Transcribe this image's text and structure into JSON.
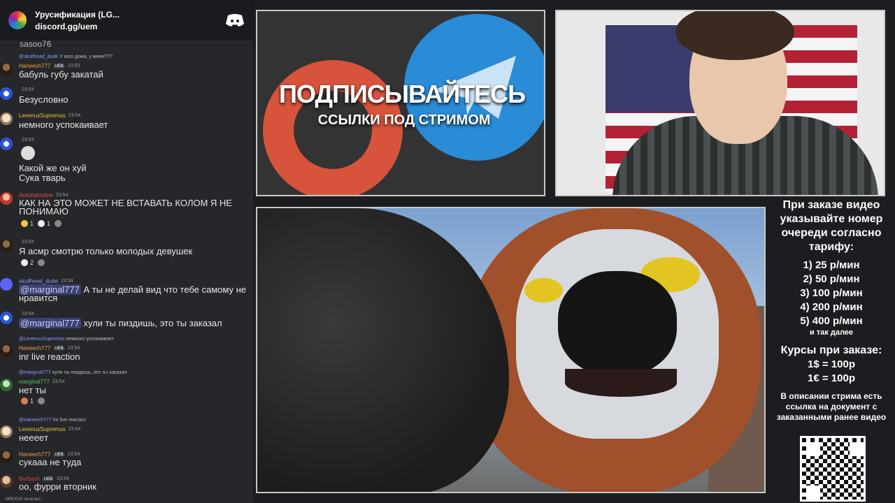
{
  "chat_header": {
    "server_name": "Урусификация (LG...",
    "invite": "discord.gg/uem",
    "icon": "discord-logo-icon"
  },
  "cut_text": "sasoo76",
  "messages": [
    {
      "reply": {
        "name": "@skullhead_dude",
        "text": "У кого дома, у меня???"
      },
      "author": "Haneech777",
      "author_color": "#f0a040",
      "badge": "UEB",
      "time": "23:53",
      "text": "бабуль губу закатай"
    },
    {
      "author": "",
      "time": "23:54",
      "text": "Безусловно"
    },
    {
      "author": "LevenusSupremus",
      "author_color": "#f0c040",
      "time": "23:54",
      "text": "немного успокаивает"
    },
    {
      "author": "",
      "time": "23:54",
      "text_line1": "Какой же он хуй",
      "text_line2": "Сука тварь"
    },
    {
      "author": "Autobatostine",
      "author_color": "#e05050",
      "time": "23:54",
      "text": "КАК НА ЭТО МОЖЕТ НЕ ВСТАВАТЬ КОЛОМ Я НЕ ПОНИМАЮ",
      "reactions": [
        "1",
        "1"
      ]
    },
    {
      "author": "",
      "time": "23:54",
      "text": "Я асмр смотрю только молодых девушек",
      "reactions": [
        "2"
      ]
    },
    {
      "author": "skullhead_dude",
      "author_color": "#8c9bff",
      "time": "23:54",
      "mention": "@marginal777",
      "text": " А ты не делай вид что тебе самому не нравится"
    },
    {
      "author": "",
      "time": "23:54",
      "mention": "@marginal777",
      "text": " хули ты пиздишь, это ты заказал"
    },
    {
      "reply": {
        "name": "@LevenusSupremus",
        "text": "немного успокаивает"
      },
      "author": "Haneech777",
      "author_color": "#f0a040",
      "badge": "UEB",
      "time": "23:54",
      "text": "inr live reaction"
    },
    {
      "reply": {
        "name": "@marginal777",
        "text": "хули ты пиздишь, это ты заказал"
      },
      "author": "marginal777",
      "author_color": "#50c050",
      "time": "23:54",
      "text": "нет ты",
      "reactions": [
        "1"
      ]
    },
    {
      "reply": {
        "name": "@Haneech777",
        "text": "inr live reaction"
      },
      "author": "LevenusSupremus",
      "author_color": "#f0c040",
      "time": "23:54",
      "text": "нееeeт"
    },
    {
      "author": "Haneech777",
      "author_color": "#f0a040",
      "badge": "UEB",
      "time": "23:54",
      "text": "сукааа не туда"
    },
    {
      "author": "Burbach",
      "author_color": "#e04040",
      "badge": "UEB",
      "time": "23:54",
      "text": "оо, фурри вторник"
    }
  ],
  "typing": "MIB2024 печатает...",
  "promo": {
    "title": "ПОДПИСЫВАЙТЕСЬ",
    "subtitle": "ССЫЛКИ ПОД СТРИМОМ"
  },
  "info": {
    "heading": "При заказе видео указывайте номер очереди согласно тарифу:",
    "tariffs": [
      "1) 25 р/мин",
      "2) 50 р/мин",
      "3) 100 р/мин",
      "4) 200 р/мин",
      "5) 400 р/мин"
    ],
    "etc": "и так далее",
    "rates_title": "Курсы при заказе:",
    "rates": [
      "1$ = 100р",
      "1€ = 100р"
    ],
    "description": "В описании стрима есть ссылка на документ с заказанными ранее видео"
  }
}
